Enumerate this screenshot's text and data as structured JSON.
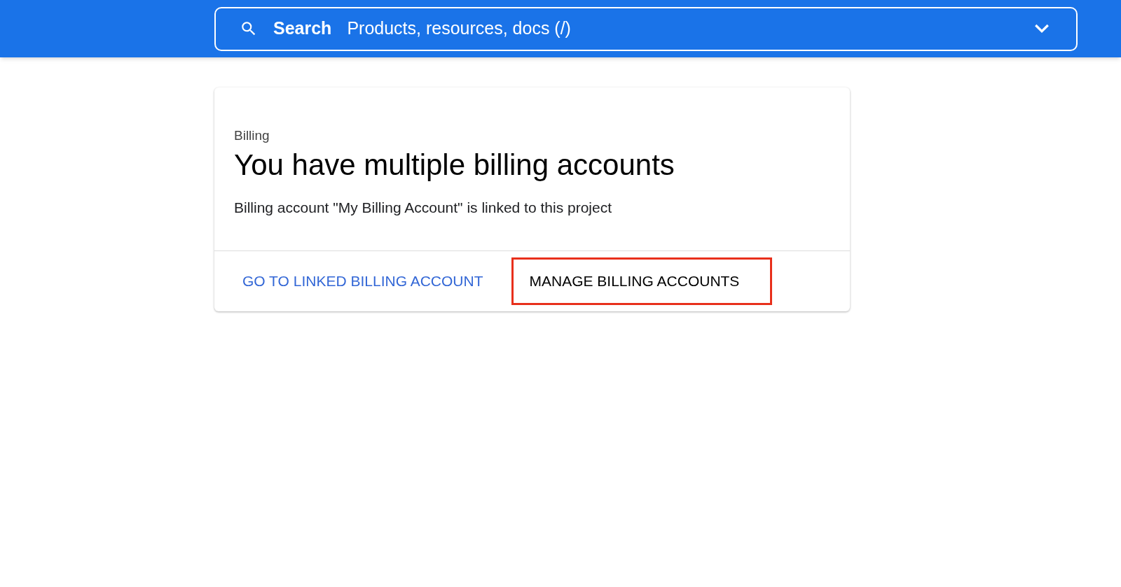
{
  "search": {
    "label": "Search",
    "placeholder": "Products, resources, docs (/)"
  },
  "card": {
    "eyebrow": "Billing",
    "title": "You have multiple billing accounts",
    "body": "Billing account \"My Billing Account\" is linked to this project",
    "actions": [
      {
        "label": "GO TO LINKED BILLING ACCOUNT",
        "kind": "link",
        "highlighted": false
      },
      {
        "label": "MANAGE BILLING ACCOUNTS",
        "kind": "plain",
        "highlighted": true
      }
    ]
  }
}
